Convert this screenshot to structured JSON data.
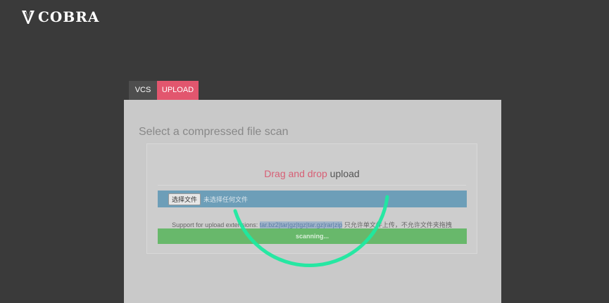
{
  "header": {
    "logo_text": "COBRA"
  },
  "tabs": [
    {
      "label": "VCS"
    },
    {
      "label": "UPLOAD"
    }
  ],
  "panel": {
    "title": "Select a compressed file scan",
    "drop_highlight": "Drag and drop",
    "drop_rest": " upload",
    "file_button_label": "选择文件",
    "file_status": "未选择任何文件",
    "support_prefix": "Support for upload extensions: ",
    "support_extensions": "tar.bz2|tar|gz|tgz|tar.gz|rar|zip",
    "support_suffix": " 只允许单文件上传，不允许文件夹拖拽",
    "scan_status": "scanning..."
  },
  "colors": {
    "background": "#3a3a3a",
    "tab_active": "#e2566e",
    "tab_inactive": "#4e4e4e",
    "panel": "#c9c9c9",
    "file_bar": "#6d9eb8",
    "scan_bar": "#68b86b",
    "spinner": "#1de9a0"
  }
}
